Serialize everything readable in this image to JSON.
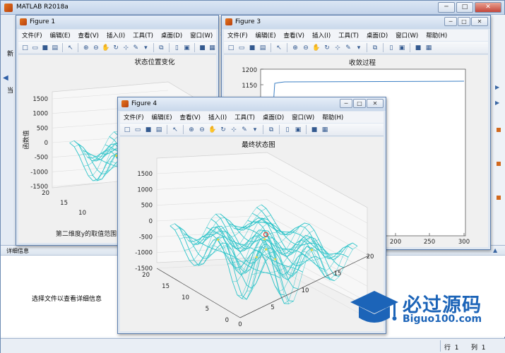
{
  "main": {
    "title": "MATLAB R2018a",
    "strip_labels": [
      "新",
      "当"
    ],
    "detail_title": "详细信息",
    "detail_info": "选择文件以查看详细信息",
    "status_row_label": "行",
    "status_row": "1",
    "status_col_label": "列",
    "status_col": "1",
    "winbtns": {
      "min": "─",
      "max": "□",
      "close": "✕"
    }
  },
  "menus": [
    "文件(F)",
    "编辑(E)",
    "查看(V)",
    "插入(I)",
    "工具(T)",
    "桌面(D)",
    "窗口(W)",
    "帮助(H)"
  ],
  "fig1": {
    "title": "Figure 1",
    "plot_title": "状态位置变化",
    "zlabel": "函数值",
    "ylabel": "第二维度y的取值范围",
    "zticks": [
      "1500",
      "1000",
      "500",
      "0",
      "-500",
      "-1000",
      "-1500"
    ],
    "yticks": [
      "20",
      "15",
      "10"
    ]
  },
  "fig3": {
    "title": "Figure 3",
    "plot_title": "收敛过程",
    "yticks": [
      "1200",
      "1150"
    ],
    "xticks": [
      "200",
      "250",
      "300"
    ]
  },
  "fig4": {
    "title": "Figure 4",
    "plot_title": "最终状态图",
    "zticks": [
      "1500",
      "1000",
      "500",
      "0",
      "-500",
      "-1000",
      "-1500"
    ],
    "yticks": [
      "20",
      "15",
      "10",
      "5",
      "0"
    ],
    "xticks": [
      "0",
      "5",
      "10",
      "15",
      "20"
    ]
  },
  "logo": {
    "cn": "必过源码",
    "en": "Biguo100.com"
  },
  "colors": {
    "surface": "#2ec4c9",
    "peak": "#e3d44a",
    "line": "#3b7fc4"
  }
}
